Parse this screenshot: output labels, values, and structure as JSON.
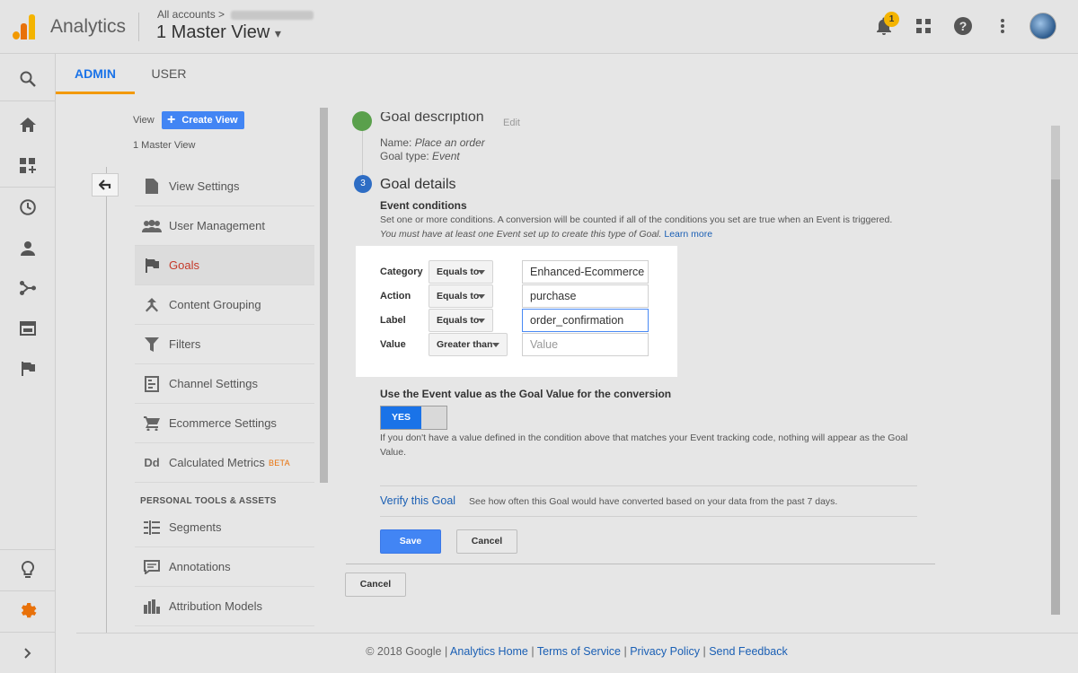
{
  "header": {
    "app_name": "Analytics",
    "breadcrumb_prefix": "All accounts",
    "breadcrumb_sep": ">",
    "view_name": "1 Master View",
    "view_caret": "▾",
    "notification_count": "1"
  },
  "tabs": {
    "admin": "ADMIN",
    "user": "USER"
  },
  "admin_column": {
    "view_label": "View",
    "create_view": "Create View",
    "view_sub": "1 Master View",
    "items": [
      {
        "label": "View Settings"
      },
      {
        "label": "User Management"
      },
      {
        "label": "Goals"
      },
      {
        "label": "Content Grouping"
      },
      {
        "label": "Filters"
      },
      {
        "label": "Channel Settings"
      },
      {
        "label": "Ecommerce Settings"
      },
      {
        "label": "Calculated Metrics",
        "badge": "BETA"
      }
    ],
    "personal_header": "PERSONAL TOOLS & ASSETS",
    "personal_items": [
      {
        "label": "Segments"
      },
      {
        "label": "Annotations"
      },
      {
        "label": "Attribution Models"
      }
    ]
  },
  "goal": {
    "desc_title": "Goal description",
    "desc_edit": "Edit",
    "name_label": "Name:",
    "name_value": "Place an order",
    "type_label": "Goal type:",
    "type_value": "Event",
    "step_number": "3",
    "details_title": "Goal details",
    "event_conditions_title": "Event conditions",
    "event_conditions_desc": "Set one or more conditions. A conversion will be counted if all of the conditions you set are true when an Event is triggered.",
    "event_conditions_note": "You must have at least one Event set up to create this type of Goal.",
    "learn_more": "Learn more",
    "conditions": [
      {
        "label": "Category",
        "operator": "Equals to",
        "value": "Enhanced-Ecommerce",
        "placeholder": ""
      },
      {
        "label": "Action",
        "operator": "Equals to",
        "value": "purchase",
        "placeholder": ""
      },
      {
        "label": "Label",
        "operator": "Equals to",
        "value": "order_confirmation",
        "placeholder": ""
      },
      {
        "label": "Value",
        "operator": "Greater than",
        "value": "",
        "placeholder": "Value"
      }
    ],
    "use_value_label": "Use the Event value as the Goal Value for the conversion",
    "toggle_label": "YES",
    "toggle_help": "If you don't have a value defined in the condition above that matches your Event tracking code, nothing will appear as the Goal Value.",
    "verify_link": "Verify this Goal",
    "verify_desc": "See how often this Goal would have converted based on your data from the past 7 days.",
    "save": "Save",
    "cancel": "Cancel",
    "cancel_outer": "Cancel"
  },
  "footer": {
    "copyright": "© 2018 Google",
    "links": [
      "Analytics Home",
      "Terms of Service",
      "Privacy Policy",
      "Send Feedback"
    ],
    "sep": "|"
  },
  "colors": {
    "accent_blue": "#4285f4",
    "link_blue": "#1a5fb4",
    "active_red": "#c53929",
    "tab_underline": "#f29900",
    "settings_orange": "#e8710a",
    "step_done_green": "#5aa04c"
  }
}
